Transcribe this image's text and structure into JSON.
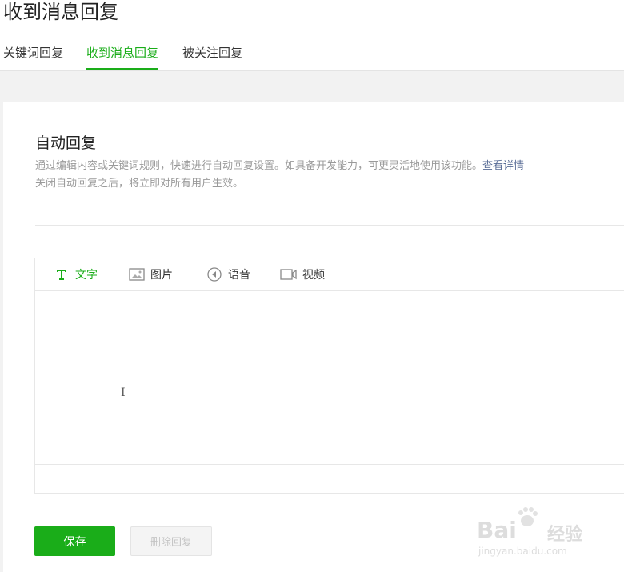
{
  "header": {
    "title": "收到消息回复",
    "tabs": [
      {
        "label": "关键词回复",
        "active": false
      },
      {
        "label": "收到消息回复",
        "active": true
      },
      {
        "label": "被关注回复",
        "active": false
      }
    ]
  },
  "section": {
    "title": "自动回复",
    "description_line1": "通过编辑内容或关键词规则，快速进行自动回复设置。如具备开发能力，可更灵活地使用该功能。",
    "details_link": "查看详情",
    "description_line2": "关闭自动回复之后，将立即对所有用户生效。"
  },
  "editor": {
    "tools": [
      {
        "label": "文字",
        "icon": "text-icon",
        "active": true
      },
      {
        "label": "图片",
        "icon": "image-icon",
        "active": false
      },
      {
        "label": "语音",
        "icon": "audio-icon",
        "active": false
      },
      {
        "label": "视频",
        "icon": "video-icon",
        "active": false
      }
    ],
    "text_value": ""
  },
  "actions": {
    "save_label": "保存",
    "delete_label": "删除回复"
  },
  "watermark": {
    "logo": "Bai",
    "logo_suffix": "经验",
    "url": "jingyan.baidu.com"
  },
  "colors": {
    "accent": "#1aad19",
    "link": "#576b95",
    "muted_text": "#9a9a9a"
  }
}
